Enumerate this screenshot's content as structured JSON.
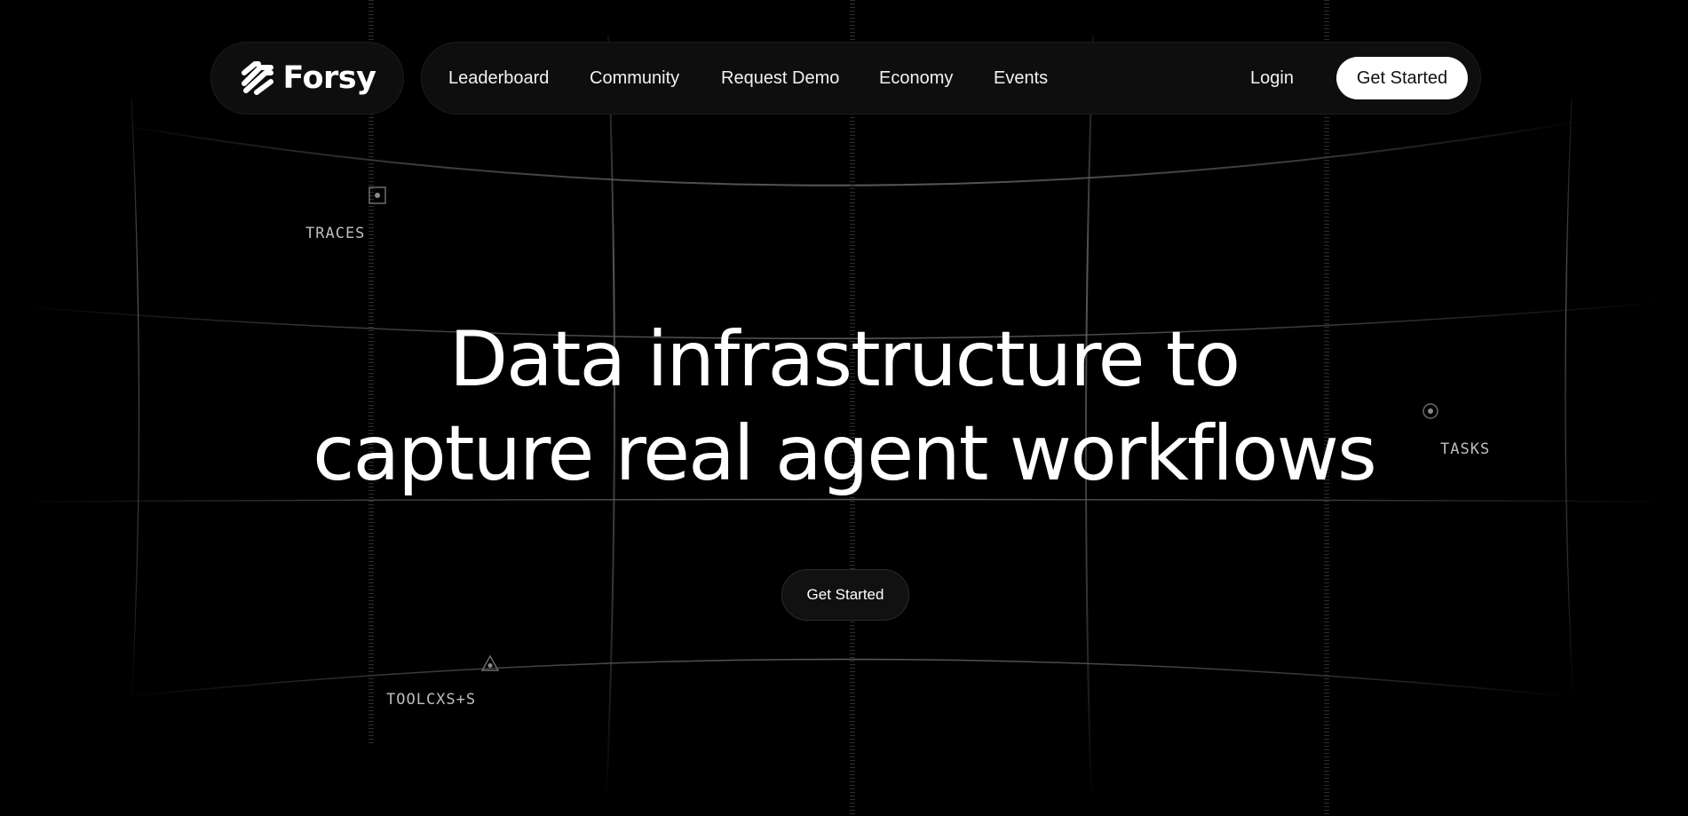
{
  "brand": {
    "name": "Forsy",
    "logo_icon": "forsy-logo-mark"
  },
  "nav": {
    "items": [
      {
        "label": "Leaderboard"
      },
      {
        "label": "Community"
      },
      {
        "label": "Request Demo"
      },
      {
        "label": "Economy"
      },
      {
        "label": "Events"
      }
    ],
    "login_label": "Login",
    "cta_label": "Get Started"
  },
  "tags": {
    "traces": "TRACES",
    "tasks": "TASKS",
    "tools": "TOOLCXS+S"
  },
  "hero": {
    "line1": "Data infrastructure to",
    "line2": "capture real agent workflows",
    "cta_label": "Get Started"
  },
  "colors": {
    "background": "#000000",
    "pill_background": "#0e0e0e",
    "cta_primary_bg": "#ffffff",
    "cta_secondary_bg": "#111111",
    "grid_line": "#3a3a3a"
  }
}
